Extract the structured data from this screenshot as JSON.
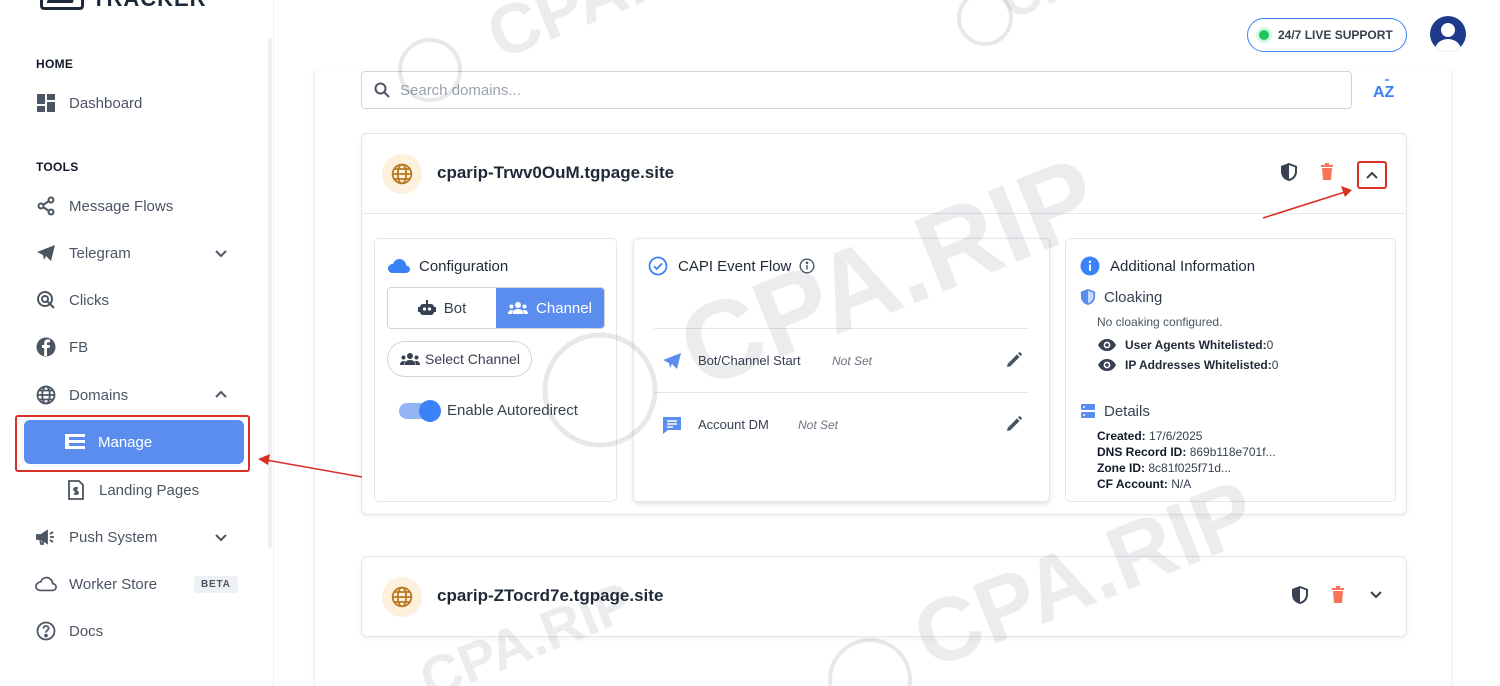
{
  "brand": {
    "name": "TRACKER"
  },
  "sidebar": {
    "section_home": "HOME",
    "section_tools": "TOOLS",
    "items": [
      {
        "label": "Dashboard",
        "icon": "dashboard-icon"
      },
      {
        "label": "Message Flows",
        "icon": "flow-icon"
      },
      {
        "label": "Telegram",
        "icon": "telegram-icon"
      },
      {
        "label": "Clicks",
        "icon": "click-icon"
      },
      {
        "label": "FB",
        "icon": "facebook-icon"
      },
      {
        "label": "Domains",
        "icon": "globe-icon"
      },
      {
        "label": "Manage",
        "icon": "list-icon",
        "active": true
      },
      {
        "label": "Landing Pages",
        "icon": "page-icon"
      },
      {
        "label": "Push System",
        "icon": "megaphone-icon"
      },
      {
        "label": "Worker Store",
        "icon": "cloud-icon",
        "badge": "BETA"
      },
      {
        "label": "Docs",
        "icon": "help-icon"
      }
    ]
  },
  "header": {
    "support_label": "24/7 LIVE SUPPORT"
  },
  "search": {
    "placeholder": "Search domains...",
    "sort_label": "AZ"
  },
  "domains": [
    {
      "name": "cparip-Trwv0OuM.tgpage.site",
      "expanded": true,
      "configuration": {
        "title": "Configuration",
        "bot_label": "Bot",
        "channel_label": "Channel",
        "select_channel_label": "Select Channel",
        "autoredirect_label": "Enable Autoredirect"
      },
      "capi": {
        "title": "CAPI Event Flow",
        "rows": [
          {
            "label": "Bot/Channel Start",
            "value": "Not Set"
          },
          {
            "label": "Account DM",
            "value": "Not Set"
          }
        ]
      },
      "additional": {
        "title": "Additional Information",
        "cloaking_title": "Cloaking",
        "cloaking_status": "No cloaking configured.",
        "ua_label": "User Agents Whitelisted:",
        "ua_value": "0",
        "ip_label": "IP Addresses Whitelisted:",
        "ip_value": "0",
        "details_title": "Details",
        "created_label": "Created:",
        "created_value": "17/6/2025",
        "dns_label": "DNS Record ID:",
        "dns_value": "869b118e701f...",
        "zone_label": "Zone ID:",
        "zone_value": "8c81f025f71d...",
        "cf_label": "CF Account:",
        "cf_value": "N/A"
      }
    },
    {
      "name": "cparip-ZTocrd7e.tgpage.site",
      "expanded": false
    }
  ],
  "watermark": {
    "text": "CPA.RIP"
  },
  "colors": {
    "accent": "#5b8def",
    "danger": "#f97356",
    "highlight": "#d93025",
    "live": "#22c55e"
  }
}
